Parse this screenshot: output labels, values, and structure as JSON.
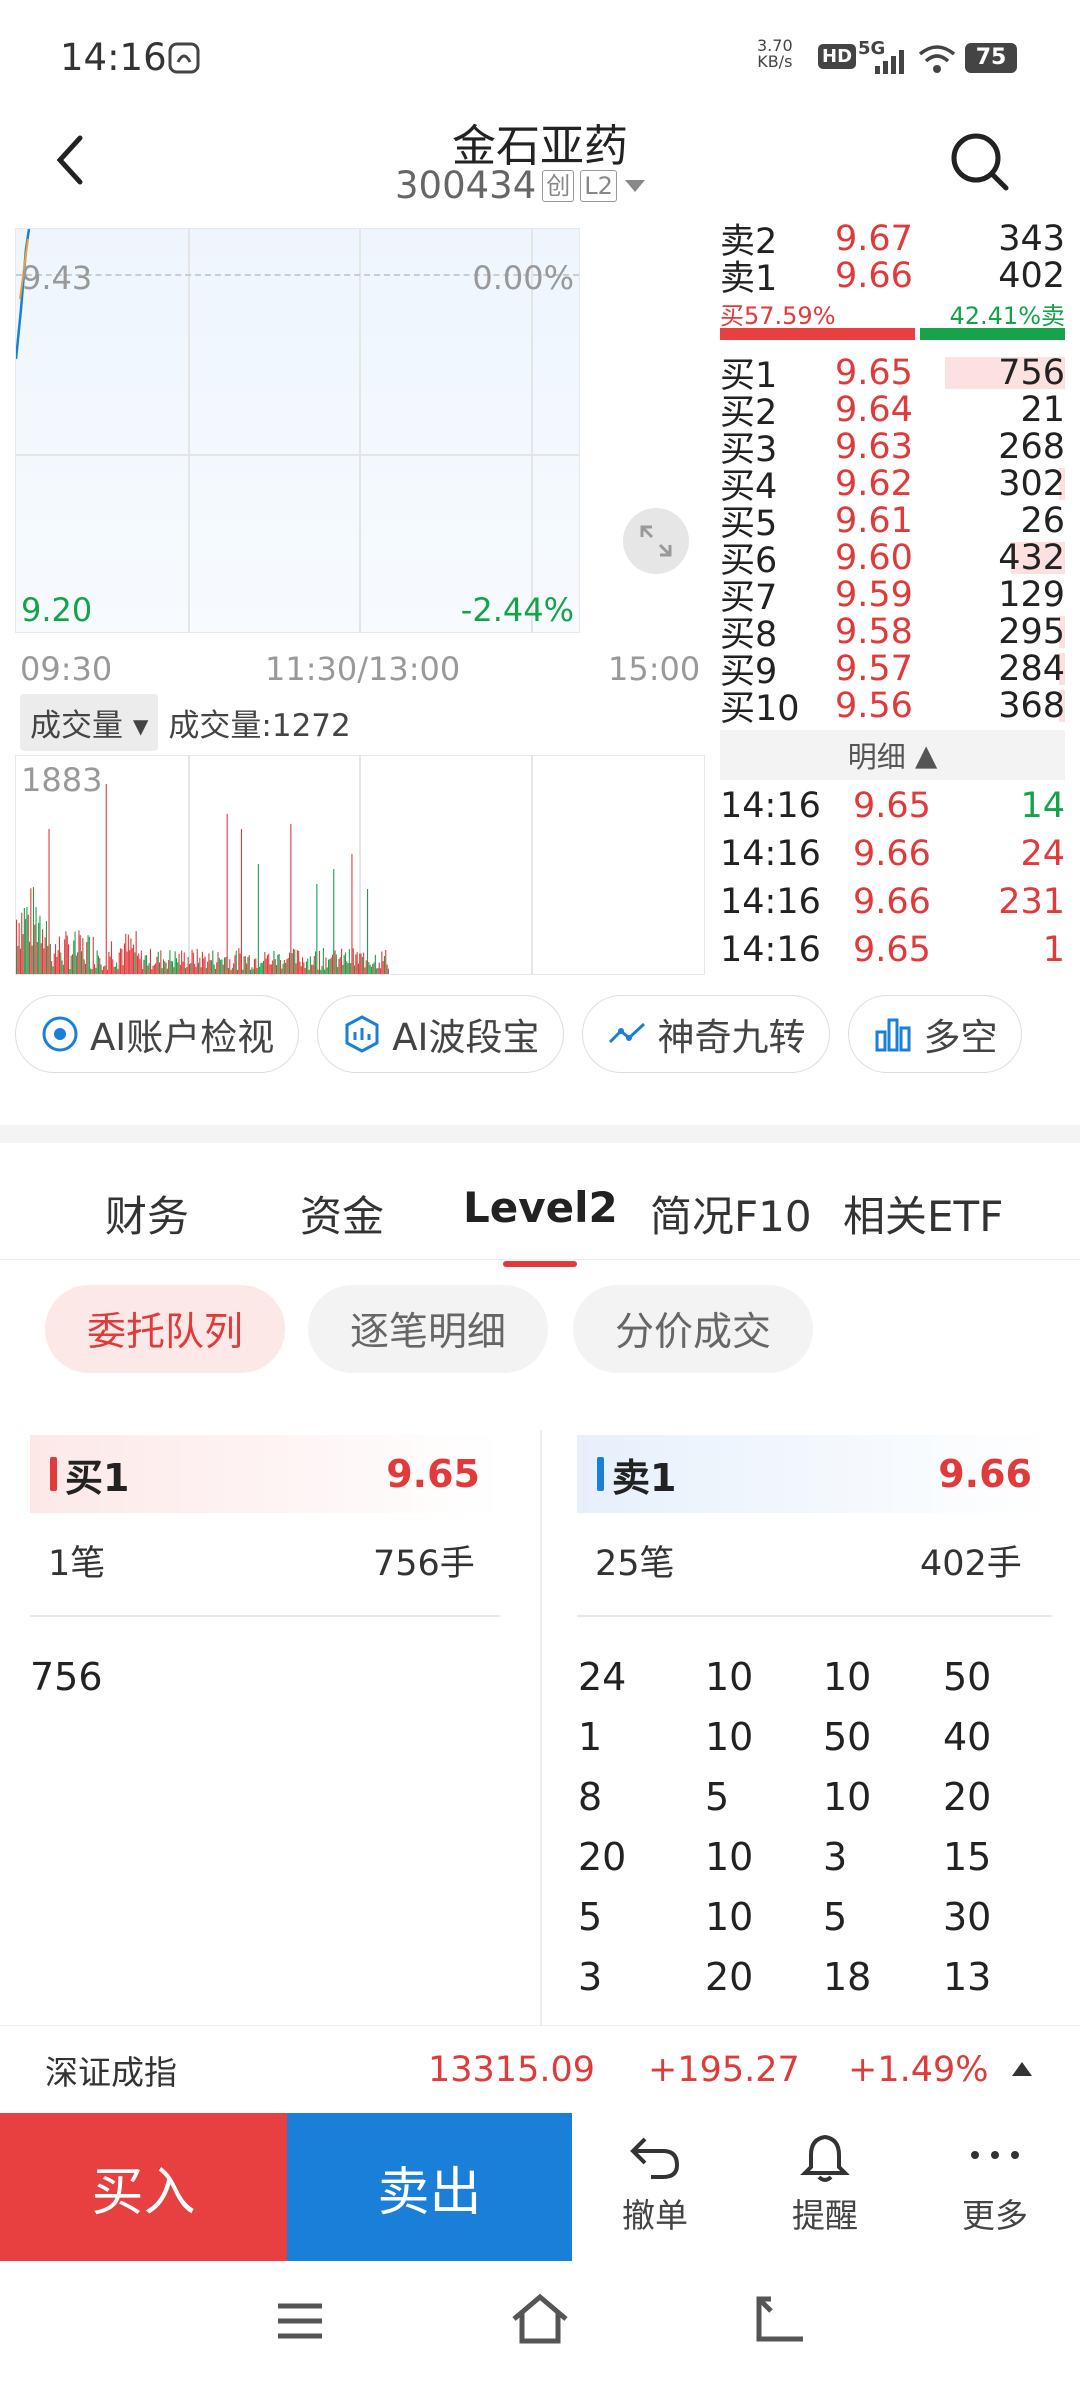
{
  "status": {
    "time": "14:16",
    "net_speed": "3.70\nKB/s",
    "speed_top": "3.70",
    "speed_bot": "KB/s",
    "hd": "HD",
    "signal": "5G",
    "battery": "75"
  },
  "header": {
    "title": "金石亚药",
    "code": "300434",
    "tag1": "创",
    "tag2": "L2"
  },
  "chart": {
    "price_top": "9.43",
    "pct_top": "0.00%",
    "price_bottom": "9.20",
    "pct_bottom": "-2.44%",
    "t_start": "09:30",
    "t_mid": "11:30/13:00",
    "t_end": "15:00"
  },
  "volume": {
    "selector": "成交量",
    "label": "成交量:1272",
    "max": "1883"
  },
  "book": {
    "sells": [
      {
        "label": "卖2",
        "price": "9.67",
        "qty": "343"
      },
      {
        "label": "卖1",
        "price": "9.66",
        "qty": "402"
      }
    ],
    "buy_ratio": "买57.59%",
    "sell_ratio": "42.41%卖",
    "buys": [
      {
        "label": "买1",
        "price": "9.65",
        "qty": "756",
        "bar": 1.0
      },
      {
        "label": "买2",
        "price": "9.64",
        "qty": "21",
        "bar": 0
      },
      {
        "label": "买3",
        "price": "9.63",
        "qty": "268",
        "bar": 0
      },
      {
        "label": "买4",
        "price": "9.62",
        "qty": "302",
        "bar": 0.05
      },
      {
        "label": "买5",
        "price": "9.61",
        "qty": "26",
        "bar": 0
      },
      {
        "label": "买6",
        "price": "9.60",
        "qty": "432",
        "bar": 0.45
      },
      {
        "label": "买7",
        "price": "9.59",
        "qty": "129",
        "bar": 0
      },
      {
        "label": "买8",
        "price": "9.58",
        "qty": "295",
        "bar": 0.05
      },
      {
        "label": "买9",
        "price": "9.57",
        "qty": "284",
        "bar": 0.05
      },
      {
        "label": "买10",
        "price": "9.56",
        "qty": "368",
        "bar": 0.05
      }
    ],
    "detail_label": "明细",
    "ticks": [
      {
        "time": "14:16",
        "price": "9.65",
        "qty": "14",
        "color": "green"
      },
      {
        "time": "14:16",
        "price": "9.66",
        "qty": "24",
        "color": "red"
      },
      {
        "time": "14:16",
        "price": "9.66",
        "qty": "231",
        "color": "red"
      },
      {
        "time": "14:16",
        "price": "9.65",
        "qty": "1",
        "color": "red"
      }
    ]
  },
  "ai_buttons": [
    "AI账户检视",
    "AI波段宝",
    "神奇九转",
    "多空"
  ],
  "tabs": [
    "财务",
    "资金",
    "Level2",
    "简况F10",
    "相关ETF"
  ],
  "pills": [
    "委托队列",
    "逐笔明细",
    "分价成交"
  ],
  "queue": {
    "buy": {
      "title": "买1",
      "price": "9.65",
      "count": "1笔",
      "hands": "756手",
      "values": [
        "756"
      ]
    },
    "sell": {
      "title": "卖1",
      "price": "9.66",
      "count": "25笔",
      "hands": "402手",
      "rows": [
        [
          "24",
          "10",
          "10",
          "50"
        ],
        [
          "1",
          "10",
          "50",
          "40"
        ],
        [
          "8",
          "5",
          "10",
          "20"
        ],
        [
          "20",
          "10",
          "3",
          "15"
        ],
        [
          "5",
          "10",
          "5",
          "30"
        ],
        [
          "3",
          "20",
          "18",
          "13"
        ]
      ]
    }
  },
  "index": {
    "name": "深证成指",
    "value": "13315.09",
    "change": "+195.27",
    "pct": "+1.49%"
  },
  "actions": {
    "buy": "买入",
    "sell": "卖出",
    "cancel": "撤单",
    "alert": "提醒",
    "more": "更多"
  },
  "colors": {
    "up": "#e03a3a",
    "down": "#15a34a",
    "buy_bg": "#e84040",
    "sell_bg": "#1a7fd8"
  }
}
